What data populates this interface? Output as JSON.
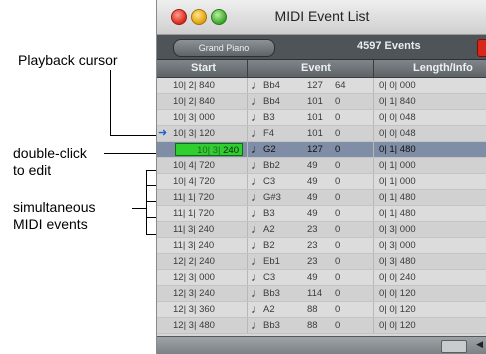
{
  "window": {
    "title": "MIDI Event List",
    "track_selector": "Grand Piano",
    "event_count": "4597 Events"
  },
  "columns": {
    "start": "Start",
    "event": "Event",
    "length": "Length/Info"
  },
  "rows": [
    {
      "start": "10| 2| 840",
      "note": "Bb4",
      "vel": "127",
      "off": "64",
      "len": "0| 0| 000"
    },
    {
      "start": "10| 2| 840",
      "note": "Bb4",
      "vel": "101",
      "off": "0",
      "len": "0| 1| 840"
    },
    {
      "start": "10| 3| 000",
      "note": "B3",
      "vel": "101",
      "off": "0",
      "len": "0| 0| 048"
    },
    {
      "start": "10| 3| 120",
      "note": "F4",
      "vel": "101",
      "off": "0",
      "len": "0| 0| 048"
    },
    {
      "start": "10| 3| 240",
      "note": "G2",
      "vel": "127",
      "off": "0",
      "len": "0| 1| 480"
    },
    {
      "start": "10| 4| 720",
      "note": "Bb2",
      "vel": "49",
      "off": "0",
      "len": "0| 1| 000"
    },
    {
      "start": "10| 4| 720",
      "note": "C3",
      "vel": "49",
      "off": "0",
      "len": "0| 1| 000"
    },
    {
      "start": "11| 1| 720",
      "note": "G#3",
      "vel": "49",
      "off": "0",
      "len": "0| 1| 480"
    },
    {
      "start": "11| 1| 720",
      "note": "B3",
      "vel": "49",
      "off": "0",
      "len": "0| 1| 480"
    },
    {
      "start": "11| 3| 240",
      "note": "A2",
      "vel": "23",
      "off": "0",
      "len": "0| 3| 000"
    },
    {
      "start": "11| 3| 240",
      "note": "B2",
      "vel": "23",
      "off": "0",
      "len": "0| 3| 000"
    },
    {
      "start": "12| 2| 240",
      "note": "Eb1",
      "vel": "23",
      "off": "0",
      "len": "0| 3| 480"
    },
    {
      "start": "12| 3| 000",
      "note": "C3",
      "vel": "49",
      "off": "0",
      "len": "0| 0| 240"
    },
    {
      "start": "12| 3| 240",
      "note": "Bb3",
      "vel": "114",
      "off": "0",
      "len": "0| 0| 120"
    },
    {
      "start": "12| 3| 360",
      "note": "A2",
      "vel": "88",
      "off": "0",
      "len": "0| 0| 120"
    },
    {
      "start": "12| 3| 480",
      "note": "Bb3",
      "vel": "88",
      "off": "0",
      "len": "0| 0| 120"
    }
  ],
  "edit_field": {
    "prefix": "10| 3|",
    "value": "240"
  },
  "annotations": {
    "playback_cursor": "Playback cursor",
    "double_click_1": "double-click",
    "double_click_2": "to edit",
    "simultaneous_1": "simultaneous",
    "simultaneous_2": "MIDI events"
  },
  "icons": {
    "note": "quarter-note-icon",
    "cursor": "playback-arrow-icon"
  },
  "colors": {
    "selection": "#7f8ea6",
    "edit_field": "#2fcf2f",
    "cursor_arrow": "#1f5fd0"
  }
}
